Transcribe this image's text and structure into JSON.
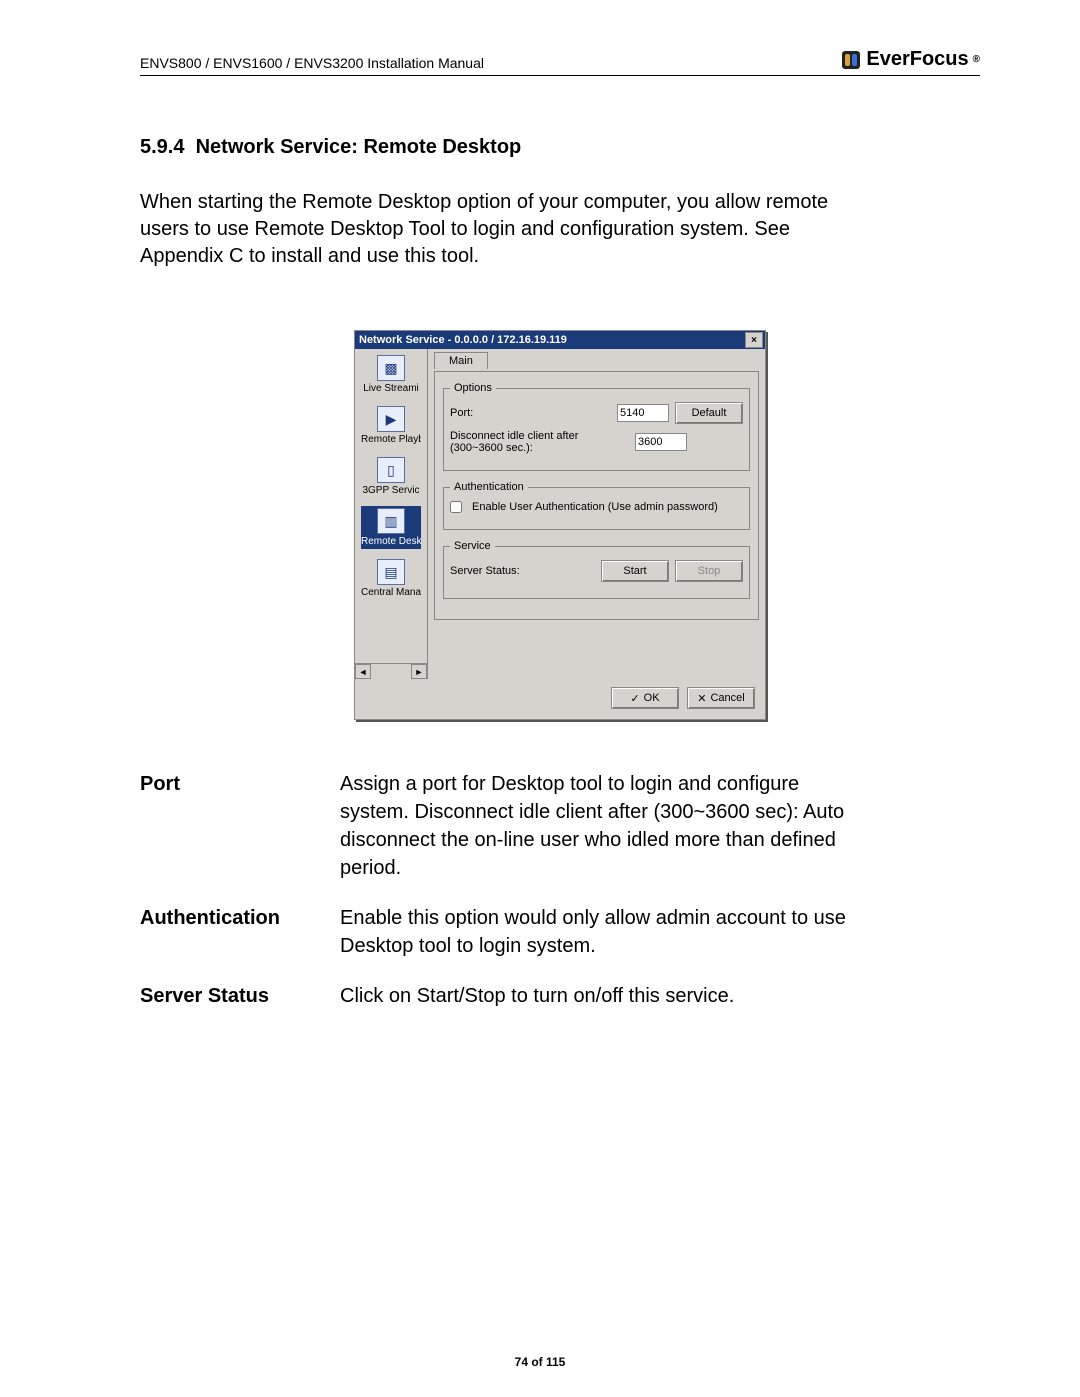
{
  "header": {
    "left": "ENVS800 / ENVS1600 / ENVS3200 Installation Manual",
    "brand": "EverFocus",
    "reg": "®"
  },
  "section": {
    "number": "5.9.4",
    "title": "Network Service: Remote Desktop",
    "intro": "When starting the Remote Desktop option of your computer, you allow remote users to use Remote Desktop Tool to login and configuration system. See Appendix C to install and use this tool."
  },
  "window": {
    "title": "Network Service - 0.0.0.0 / 172.16.19.119",
    "close": "×",
    "sidebar": {
      "items": [
        {
          "label": "Live Streami",
          "glyph": "▩"
        },
        {
          "label": "Remote Playb",
          "glyph": "▶"
        },
        {
          "label": "3GPP Servic",
          "glyph": "▯"
        },
        {
          "label": "Remote Desk",
          "glyph": "▥"
        },
        {
          "label": "Central Managemen",
          "glyph": "▤"
        }
      ],
      "scroll_left": "◄",
      "scroll_right": "►"
    },
    "tab_main": "Main",
    "groups": {
      "options": {
        "legend": "Options",
        "port_label": "Port:",
        "port_value": "5140",
        "default_btn": "Default",
        "disconnect_label": "Disconnect idle client after (300~3600 sec.):",
        "disconnect_value": "3600"
      },
      "auth": {
        "legend": "Authentication",
        "checkbox_label": "Enable User Authentication (Use admin password)"
      },
      "service": {
        "legend": "Service",
        "status_label": "Server Status:",
        "start_btn": "Start",
        "stop_btn": "Stop"
      }
    },
    "footer": {
      "ok": "OK",
      "cancel": "Cancel",
      "ok_glyph": "✓",
      "cancel_glyph": "✕"
    }
  },
  "definitions": {
    "port": {
      "term": "Port",
      "desc": "Assign a port for Desktop tool to login and configure system. Disconnect idle client after (300~3600 sec): Auto disconnect the on-line user who idled more than defined period."
    },
    "auth": {
      "term": "Authentication",
      "desc": "Enable this option would only allow admin account to use Desktop tool to login system."
    },
    "status": {
      "term": "Server Status",
      "desc": "Click on Start/Stop to turn on/off this service."
    }
  },
  "footer": {
    "page": "74 of 115"
  }
}
